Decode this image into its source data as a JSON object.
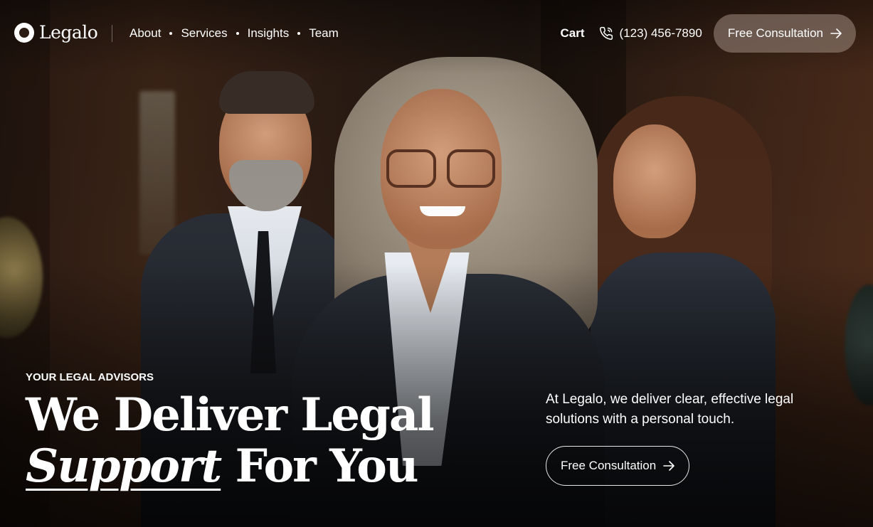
{
  "brand": {
    "name": "Legalo"
  },
  "nav": {
    "items": [
      {
        "label": "About"
      },
      {
        "label": "Services"
      },
      {
        "label": "Insights"
      },
      {
        "label": "Team"
      }
    ],
    "cart_label": "Cart",
    "phone": "(123) 456-7890",
    "cta_label": "Free Consultation"
  },
  "hero": {
    "eyebrow": "YOUR LEGAL ADVISORS",
    "headline_line1": "We Deliver Legal",
    "headline_em": "Support",
    "headline_rest": "For You",
    "description": "At Legalo, we deliver clear, effective legal solutions with a personal touch.",
    "cta_label": "Free Consultation"
  },
  "icons": {
    "logo": "logo-ring-icon",
    "phone": "phone-icon",
    "arrow": "arrow-right-icon"
  },
  "colors": {
    "background": "#1a120d",
    "button_top_bg": "#8f7d74",
    "text": "#ffffff"
  }
}
